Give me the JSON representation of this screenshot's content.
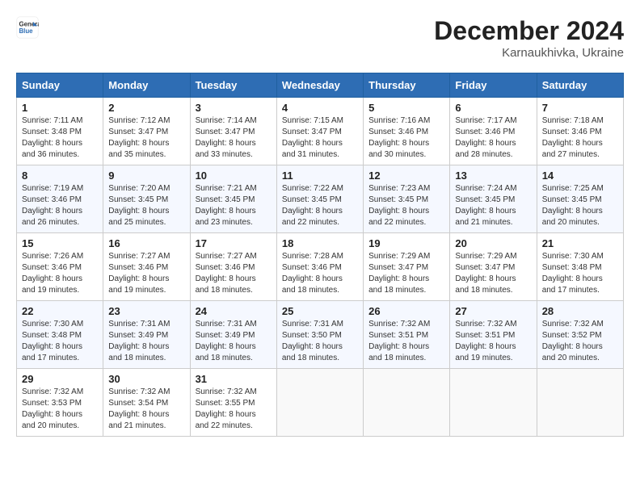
{
  "header": {
    "logo_line1": "General",
    "logo_line2": "Blue",
    "month_title": "December 2024",
    "location": "Karnaukhivka, Ukraine"
  },
  "columns": [
    "Sunday",
    "Monday",
    "Tuesday",
    "Wednesday",
    "Thursday",
    "Friday",
    "Saturday"
  ],
  "weeks": [
    [
      {
        "day": "1",
        "sunrise": "7:11 AM",
        "sunset": "3:48 PM",
        "daylight": "8 hours and 36 minutes."
      },
      {
        "day": "2",
        "sunrise": "7:12 AM",
        "sunset": "3:47 PM",
        "daylight": "8 hours and 35 minutes."
      },
      {
        "day": "3",
        "sunrise": "7:14 AM",
        "sunset": "3:47 PM",
        "daylight": "8 hours and 33 minutes."
      },
      {
        "day": "4",
        "sunrise": "7:15 AM",
        "sunset": "3:47 PM",
        "daylight": "8 hours and 31 minutes."
      },
      {
        "day": "5",
        "sunrise": "7:16 AM",
        "sunset": "3:46 PM",
        "daylight": "8 hours and 30 minutes."
      },
      {
        "day": "6",
        "sunrise": "7:17 AM",
        "sunset": "3:46 PM",
        "daylight": "8 hours and 28 minutes."
      },
      {
        "day": "7",
        "sunrise": "7:18 AM",
        "sunset": "3:46 PM",
        "daylight": "8 hours and 27 minutes."
      }
    ],
    [
      {
        "day": "8",
        "sunrise": "7:19 AM",
        "sunset": "3:46 PM",
        "daylight": "8 hours and 26 minutes."
      },
      {
        "day": "9",
        "sunrise": "7:20 AM",
        "sunset": "3:45 PM",
        "daylight": "8 hours and 25 minutes."
      },
      {
        "day": "10",
        "sunrise": "7:21 AM",
        "sunset": "3:45 PM",
        "daylight": "8 hours and 23 minutes."
      },
      {
        "day": "11",
        "sunrise": "7:22 AM",
        "sunset": "3:45 PM",
        "daylight": "8 hours and 22 minutes."
      },
      {
        "day": "12",
        "sunrise": "7:23 AM",
        "sunset": "3:45 PM",
        "daylight": "8 hours and 22 minutes."
      },
      {
        "day": "13",
        "sunrise": "7:24 AM",
        "sunset": "3:45 PM",
        "daylight": "8 hours and 21 minutes."
      },
      {
        "day": "14",
        "sunrise": "7:25 AM",
        "sunset": "3:45 PM",
        "daylight": "8 hours and 20 minutes."
      }
    ],
    [
      {
        "day": "15",
        "sunrise": "7:26 AM",
        "sunset": "3:46 PM",
        "daylight": "8 hours and 19 minutes."
      },
      {
        "day": "16",
        "sunrise": "7:27 AM",
        "sunset": "3:46 PM",
        "daylight": "8 hours and 19 minutes."
      },
      {
        "day": "17",
        "sunrise": "7:27 AM",
        "sunset": "3:46 PM",
        "daylight": "8 hours and 18 minutes."
      },
      {
        "day": "18",
        "sunrise": "7:28 AM",
        "sunset": "3:46 PM",
        "daylight": "8 hours and 18 minutes."
      },
      {
        "day": "19",
        "sunrise": "7:29 AM",
        "sunset": "3:47 PM",
        "daylight": "8 hours and 18 minutes."
      },
      {
        "day": "20",
        "sunrise": "7:29 AM",
        "sunset": "3:47 PM",
        "daylight": "8 hours and 18 minutes."
      },
      {
        "day": "21",
        "sunrise": "7:30 AM",
        "sunset": "3:48 PM",
        "daylight": "8 hours and 17 minutes."
      }
    ],
    [
      {
        "day": "22",
        "sunrise": "7:30 AM",
        "sunset": "3:48 PM",
        "daylight": "8 hours and 17 minutes."
      },
      {
        "day": "23",
        "sunrise": "7:31 AM",
        "sunset": "3:49 PM",
        "daylight": "8 hours and 18 minutes."
      },
      {
        "day": "24",
        "sunrise": "7:31 AM",
        "sunset": "3:49 PM",
        "daylight": "8 hours and 18 minutes."
      },
      {
        "day": "25",
        "sunrise": "7:31 AM",
        "sunset": "3:50 PM",
        "daylight": "8 hours and 18 minutes."
      },
      {
        "day": "26",
        "sunrise": "7:32 AM",
        "sunset": "3:51 PM",
        "daylight": "8 hours and 18 minutes."
      },
      {
        "day": "27",
        "sunrise": "7:32 AM",
        "sunset": "3:51 PM",
        "daylight": "8 hours and 19 minutes."
      },
      {
        "day": "28",
        "sunrise": "7:32 AM",
        "sunset": "3:52 PM",
        "daylight": "8 hours and 20 minutes."
      }
    ],
    [
      {
        "day": "29",
        "sunrise": "7:32 AM",
        "sunset": "3:53 PM",
        "daylight": "8 hours and 20 minutes."
      },
      {
        "day": "30",
        "sunrise": "7:32 AM",
        "sunset": "3:54 PM",
        "daylight": "8 hours and 21 minutes."
      },
      {
        "day": "31",
        "sunrise": "7:32 AM",
        "sunset": "3:55 PM",
        "daylight": "8 hours and 22 minutes."
      },
      null,
      null,
      null,
      null
    ]
  ]
}
